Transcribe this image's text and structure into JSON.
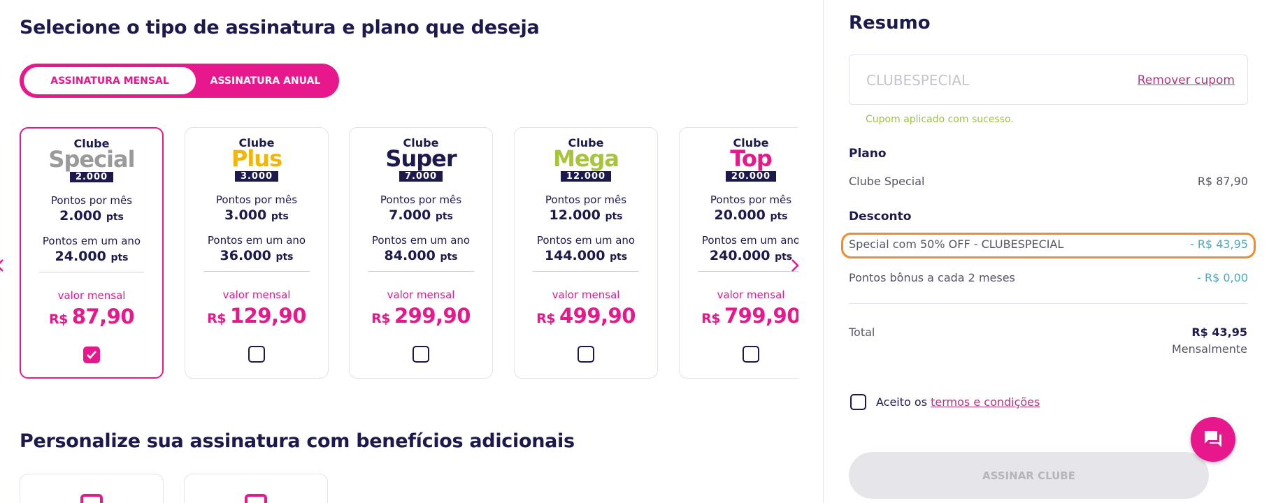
{
  "page": {
    "heading": "Selecione o tipo de assinatura e plano que deseja",
    "addons_heading": "Personalize sua assinatura com benefícios adicionais"
  },
  "subscription_toggle": {
    "monthly": "ASSINATURA MENSAL",
    "annual": "ASSINATURA ANUAL",
    "selected": "monthly"
  },
  "labels": {
    "points_month": "Pontos por mês",
    "points_year": "Pontos em um ano",
    "monthly_value": "valor mensal",
    "pts": "pts",
    "currency": "R$"
  },
  "plans": [
    {
      "clube": "Clube",
      "name": "Special",
      "badge": "2.000",
      "points_month": "2.000",
      "points_year": "24.000",
      "price": "87,90",
      "selected": true,
      "color": "#9a9a9a"
    },
    {
      "clube": "Clube",
      "name": "Plus",
      "badge": "3.000",
      "points_month": "3.000",
      "points_year": "36.000",
      "price": "129,90",
      "selected": false,
      "color": "#f2b705"
    },
    {
      "clube": "Clube",
      "name": "Super",
      "badge": "7.000",
      "points_month": "7.000",
      "points_year": "84.000",
      "price": "299,90",
      "selected": false,
      "color": "#1c1a4d"
    },
    {
      "clube": "Clube",
      "name": "Mega",
      "badge": "12.000",
      "points_month": "12.000",
      "points_year": "144.000",
      "price": "499,90",
      "selected": false,
      "color": "#a6c53a"
    },
    {
      "clube": "Clube",
      "name": "Top",
      "badge": "20.000",
      "points_month": "20.000",
      "points_year": "240.000",
      "price": "799,90",
      "selected": false,
      "color": "#e6188c"
    }
  ],
  "summary": {
    "title": "Resumo",
    "coupon_code": "CLUBESPECIAL",
    "remove_coupon": "Remover cupom",
    "coupon_success": "Cupom aplicado com sucesso.",
    "plan_heading": "Plano",
    "plan_name": "Clube Special",
    "plan_price": "R$ 87,90",
    "discount_heading": "Desconto",
    "discount_name": "Special com 50% OFF - CLUBESPECIAL",
    "discount_value": "- R$ 43,95",
    "bonus_name": "Pontos bônus a cada 2 meses",
    "bonus_value": "- R$ 0,00",
    "total_label": "Total",
    "total_value": "R$ 43,95",
    "total_period": "Mensalmente",
    "terms_prefix": "Aceito os",
    "terms_link": "termos e condições",
    "submit": "ASSINAR CLUBE"
  },
  "colors": {
    "accent": "#e6188c",
    "navy": "#1c1a4d",
    "highlight": "#f08a2c",
    "discount": "#4aa8c0",
    "success": "#9dbf4a"
  },
  "icons": [
    "chevron-right-icon",
    "chevron-left-icon",
    "checkmark-icon",
    "chat-icon",
    "bag-icon"
  ]
}
